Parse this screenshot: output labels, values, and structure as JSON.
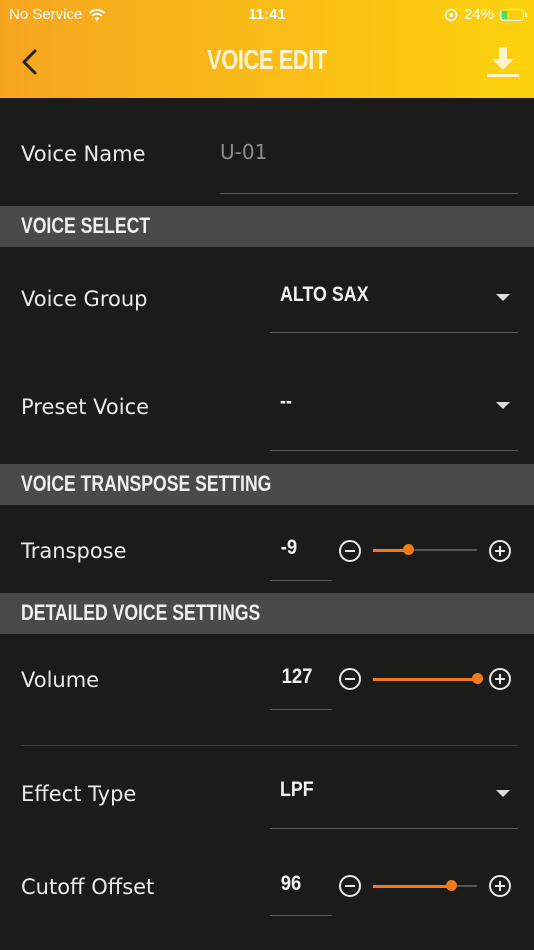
{
  "status_bar": {
    "carrier": "No Service",
    "time": "11:41",
    "battery": "24%",
    "battery_level": 0.24
  },
  "header": {
    "title": "VOICE EDIT"
  },
  "voice_name": {
    "label": "Voice Name",
    "value": "U-01"
  },
  "sections": {
    "voice_select": "VOICE SELECT",
    "transpose_setting": "VOICE TRANSPOSE SETTING",
    "detailed": "DETAILED VOICE SETTINGS"
  },
  "voice_group": {
    "label": "Voice Group",
    "value": "ALTO SAX"
  },
  "preset_voice": {
    "label": "Preset Voice",
    "value": "--"
  },
  "transpose": {
    "label": "Transpose",
    "value": "-9",
    "level": 0.34
  },
  "volume": {
    "label": "Volume",
    "value": "127",
    "level": 1.0
  },
  "effect_type": {
    "label": "Effect Type",
    "value": "LPF"
  },
  "cutoff_offset": {
    "label": "Cutoff Offset",
    "value": "96",
    "level": 0.75
  },
  "colors": {
    "accent": "#f07a1c",
    "header_start": "#f6a51f",
    "header_end": "#fdd20c"
  }
}
